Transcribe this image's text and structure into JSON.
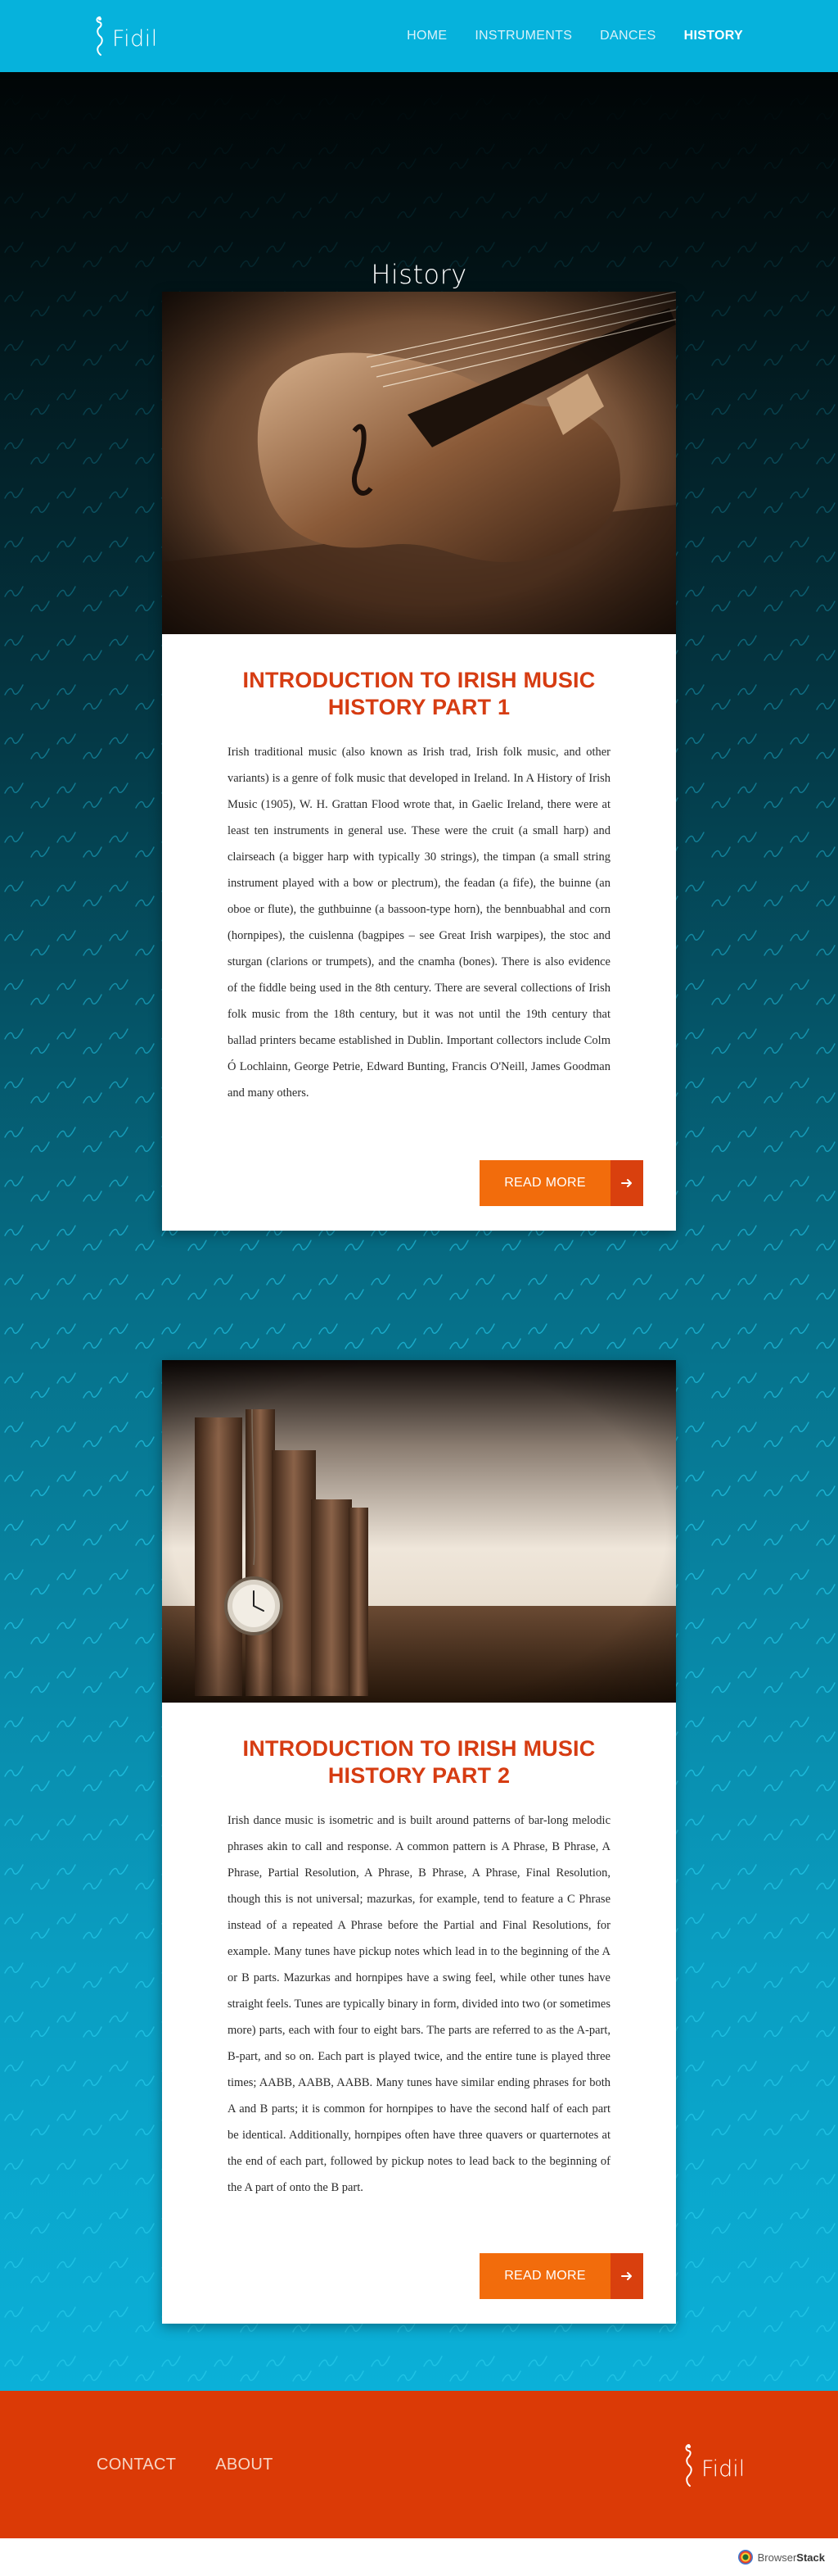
{
  "brand": {
    "name": "Fidil",
    "logo_icon": "fiddle-scroll-icon"
  },
  "nav": {
    "items": [
      {
        "label": "HOME",
        "active": false
      },
      {
        "label": "INSTRUMENTS",
        "active": false
      },
      {
        "label": "DANCES",
        "active": false
      },
      {
        "label": "HISTORY",
        "active": true
      }
    ]
  },
  "page": {
    "title": "History"
  },
  "articles": [
    {
      "image": "violin-photo",
      "title": "INTRODUCTION TO IRISH MUSIC HISTORY PART 1",
      "body": "Irish traditional music (also known as Irish trad, Irish folk music, and other variants) is a genre of folk music that developed in Ireland. In A History of Irish Music (1905), W. H. Grattan Flood wrote that, in Gaelic Ireland, there were at least ten instruments in general use. These were the cruit (a small harp) and clairseach (a bigger harp with typically 30 strings), the timpan (a small string instrument played with a bow or plectrum), the feadan (a fife), the buinne (an oboe or flute), the guthbuinne (a bassoon-type horn), the bennbuabhal and corn (hornpipes), the cuislenna (bagpipes – see Great Irish warpipes), the stoc and sturgan (clarions or trumpets), and the cnamha (bones). There is also evidence of the fiddle being used in the 8th century. There are several collections of Irish folk music from the 18th century, but it was not until the 19th century that ballad printers became established in Dublin. Important collectors include Colm Ó Lochlainn, George Petrie, Edward Bunting, Francis O'Neill, James Goodman and many others.",
      "button": "READ MORE"
    },
    {
      "image": "old-books-pocket-watch-photo",
      "title": "INTRODUCTION TO IRISH MUSIC HISTORY PART 2",
      "body": "Irish dance music is isometric and is built around patterns of bar-long melodic phrases akin to call and response. A common pattern is A Phrase, B Phrase, A Phrase, Partial Resolution, A Phrase, B Phrase, A Phrase, Final Resolution, though this is not universal; mazurkas, for example, tend to feature a C Phrase instead of a repeated A Phrase before the Partial and Final Resolutions, for example. Many tunes have pickup notes which lead in to the beginning of the A or B parts. Mazurkas and hornpipes have a swing feel, while other tunes have straight feels. Tunes are typically binary in form, divided into two (or sometimes more) parts, each with four to eight bars. The parts are referred to as the A-part, B-part, and so on. Each part is played twice, and the entire tune is played three times; AABB, AABB, AABB. Many tunes have similar ending phrases for both A and B parts; it is common for hornpipes to have the second half of each part be identical. Additionally, hornpipes often have three quavers or quarternotes at the end of each part, followed by pickup notes to lead back to the beginning of the A part of onto the B part.",
      "button": "READ MORE"
    }
  ],
  "footer": {
    "links": [
      "CONTACT",
      "ABOUT"
    ],
    "brand": "Fidil"
  },
  "watermark": {
    "prefix": "Browser",
    "bold": "Stack"
  },
  "colors": {
    "header": "#06b2dc",
    "accent_title": "#d63c12",
    "button": "#f26c0c",
    "button_arrow": "#d9400e",
    "footer": "#db3a06"
  }
}
